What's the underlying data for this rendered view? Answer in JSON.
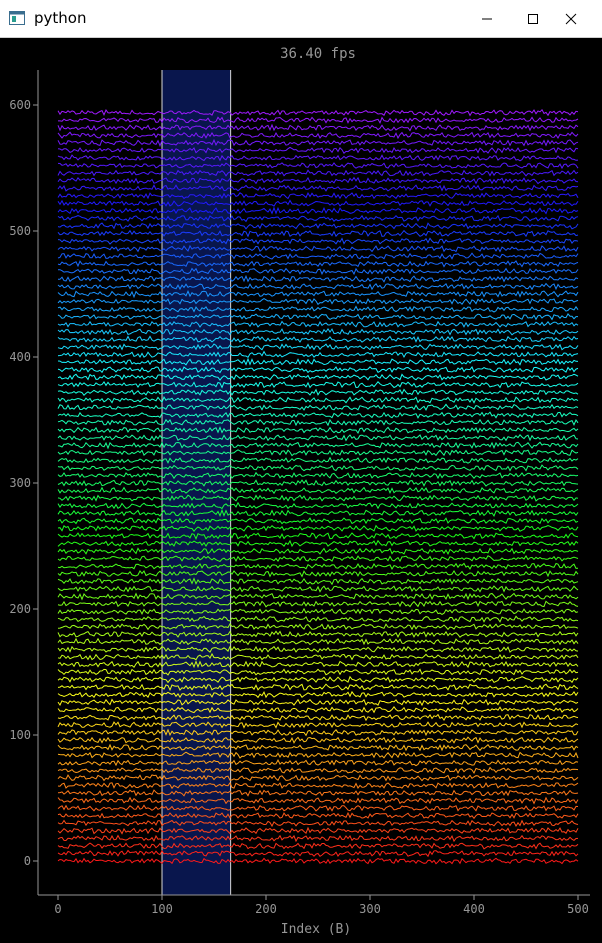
{
  "window": {
    "title": "python",
    "app_icon": "python-app-icon",
    "controls": [
      "minimize-icon",
      "maximize-icon",
      "close-icon"
    ]
  },
  "plot": {
    "fps_label": "36.40 fps",
    "x_axis_label": "Index (B)",
    "background": "#000000",
    "axis_color": "#969696",
    "region_fill": "#0a1a5a",
    "region_edge_color": "#d8d8d8"
  },
  "chart_data": {
    "type": "line",
    "title": "36.40 fps",
    "xlabel": "Index (B)",
    "ylabel": "",
    "xlim": [
      -10,
      510
    ],
    "ylim": [
      -27,
      627
    ],
    "x_ticks": [
      0,
      100,
      200,
      300,
      400,
      500
    ],
    "y_ticks": [
      0,
      100,
      200,
      300,
      400,
      500,
      600
    ],
    "x_tick_labels": [
      "0",
      "100",
      "200",
      "300",
      "400",
      "500"
    ],
    "y_tick_labels": [
      "0",
      "100",
      "200",
      "300",
      "400",
      "500",
      "600"
    ],
    "series_count": 100,
    "series_spacing": 6,
    "samples_per_series": 500,
    "series_x_range": [
      0,
      500
    ],
    "series_color_map": "hue from red (bottom) through yellow, green, cyan, blue to violet (top)",
    "selected_region": [
      100,
      166
    ],
    "grid": false,
    "legend": "none"
  }
}
